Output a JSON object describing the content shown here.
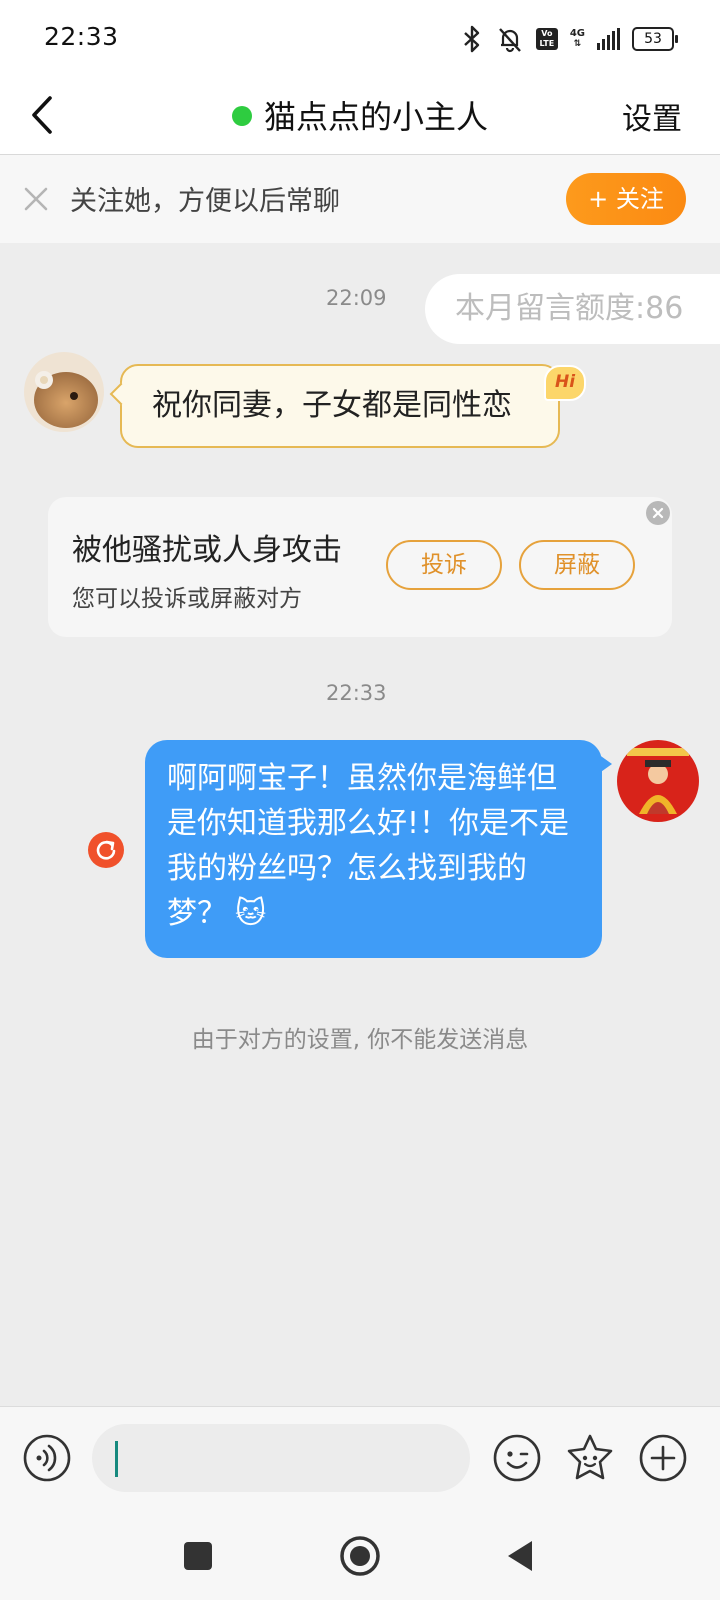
{
  "status_bar": {
    "time": "22:33",
    "network": "4G",
    "volte": "Vo LTE",
    "battery": "53"
  },
  "header": {
    "title": "猫点点的小主人",
    "settings_label": "设置",
    "online_color": "#2ecc40"
  },
  "follow_bar": {
    "text": "关注她，方便以后常聊",
    "button_label": "+ 关注"
  },
  "chat": {
    "timestamp_1": "22:09",
    "quota_text": "本月留言额度:86",
    "incoming_message": "祝你同妻，子女都是同性恋",
    "hi_badge": "Hi",
    "report": {
      "title": "被他骚扰或人身攻击",
      "subtitle": "您可以投诉或屏蔽对方",
      "complain_label": "投诉",
      "block_label": "屏蔽"
    },
    "timestamp_2": "22:33",
    "outgoing_message": "啊阿啊宝子！虽然你是海鲜但是你知道我那么好!！你是不是我的粉丝吗？怎么找到我的梦？",
    "outgoing_emoji": "🐱",
    "system_notice": "由于对方的设置, 你不能发送消息"
  },
  "colors": {
    "accent_orange": "#fb8a12",
    "outgoing_bubble": "#3f9cf7",
    "resend": "#f0512b"
  },
  "input_bar": {
    "message_value": "",
    "icons": [
      "voice-icon",
      "emoji-icon",
      "sticker-icon",
      "plus-icon"
    ]
  },
  "nav_bar": {
    "icons": [
      "recents-square-icon",
      "home-circle-icon",
      "back-triangle-icon"
    ]
  }
}
